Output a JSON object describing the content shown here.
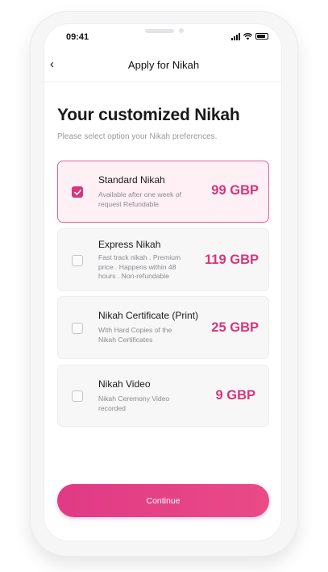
{
  "status_bar": {
    "time": "09:41"
  },
  "header": {
    "back_glyph": "‹",
    "title": "Apply for Nikah"
  },
  "page": {
    "heading": "Your customized Nikah",
    "subheading": "Please select option your Nikah preferences."
  },
  "options": [
    {
      "title": "Standard Nikah",
      "description_lines": [
        "Available after one week of",
        "request Refundable"
      ],
      "price": "99 GBP",
      "selected": true
    },
    {
      "title": "Express Nikah",
      "description_lines": [
        "Fast track nikah . Premium",
        "price . Happens within 48",
        "hours . Non-refundable"
      ],
      "price": "119 GBP",
      "selected": false
    },
    {
      "title": "Nikah Certificate (Print)",
      "description_lines": [
        "With Hard Copies of the",
        "Nikah Certificates"
      ],
      "price": "25 GBP",
      "selected": false
    },
    {
      "title": "Nikah Video",
      "description_lines": [
        "Nikah Ceremony Video",
        "recorded"
      ],
      "price": "9 GBP",
      "selected": false
    }
  ],
  "continue_label": "Continue",
  "colors": {
    "accent": "#d8357b",
    "selected_bg": "#fff0f5",
    "card_bg": "#f7f7f8"
  }
}
